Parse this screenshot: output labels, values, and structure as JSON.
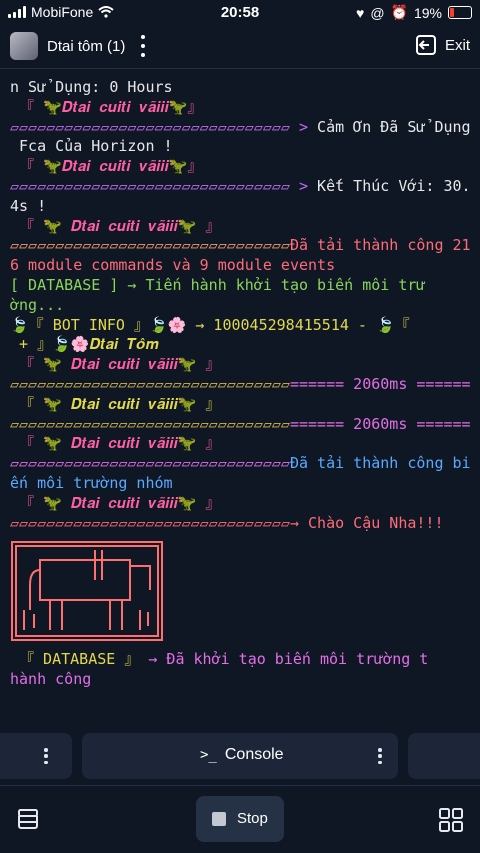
{
  "status_bar": {
    "carrier": "MobiFone",
    "time": "20:58",
    "battery": "19%"
  },
  "header": {
    "title": "Dtai tôm (1)",
    "exit_label": "Exit"
  },
  "console_lines": [
    {
      "parts": [
        {
          "t": "n Sử Dụng: 0 Hours",
          "c": "white"
        }
      ]
    },
    {
      "parts": [
        {
          "t": " 『 🦖𝑫𝒕𝒂𝒊 𝒄𝒖𝒊𝒕𝒊 𝒗𝒂̃𝒊𝒊𝒊🦖』",
          "c": "pink"
        }
      ]
    },
    {
      "parts": [
        {
          "t": "▱▱▱▱▱▱▱▱▱▱▱▱▱▱▱▱▱▱▱▱▱▱▱▱▱▱▱▱▱▱▱ > ",
          "c": "purple"
        },
        {
          "t": "Cảm Ơn Đã Sử Dụng",
          "c": "white"
        }
      ]
    },
    {
      "parts": [
        {
          "t": " Fca Của Horizon !",
          "c": "white"
        }
      ]
    },
    {
      "parts": [
        {
          "t": " 『 🦖𝑫𝒕𝒂𝒊 𝒄𝒖𝒊𝒕𝒊 𝒗𝒂̃𝒊𝒊𝒊🦖』",
          "c": "pink"
        }
      ]
    },
    {
      "parts": [
        {
          "t": "▱▱▱▱▱▱▱▱▱▱▱▱▱▱▱▱▱▱▱▱▱▱▱▱▱▱▱▱▱▱▱ > ",
          "c": "purple"
        },
        {
          "t": "Kết Thúc Với: 30.",
          "c": "white"
        }
      ]
    },
    {
      "parts": [
        {
          "t": "4s !",
          "c": "white"
        }
      ]
    },
    {
      "parts": [
        {
          "t": " 『 🦖 𝑫𝒕𝒂𝒊 𝒄𝒖𝒊𝒕𝒊 𝒗𝒂̃𝒊𝒊𝒊🦖 』",
          "c": "pink"
        }
      ]
    },
    {
      "parts": [
        {
          "t": "▱▱▱▱▱▱▱▱▱▱▱▱▱▱▱▱▱▱▱▱▱▱▱▱▱▱▱▱▱▱▱",
          "c": "orange"
        },
        {
          "t": "Đã tải thành công 21",
          "c": "red"
        }
      ]
    },
    {
      "parts": [
        {
          "t": "6 module commands và 9 module events",
          "c": "red"
        }
      ]
    },
    {
      "parts": [
        {
          "t": "[ DATABASE ] → Tiến hành khởi tạo biến môi trư",
          "c": "green"
        }
      ]
    },
    {
      "parts": [
        {
          "t": "ờng...",
          "c": "green"
        }
      ]
    },
    {
      "parts": [
        {
          "t": "🍃『 BOT INFO 』🍃🌸 → 100045298415514 - 🍃『",
          "c": "yellow"
        }
      ]
    },
    {
      "parts": [
        {
          "t": " + 』🍃🌸𝑫𝒕𝒂𝒊 𝑻𝒐̂𝒎",
          "c": "yellow"
        }
      ]
    },
    {
      "parts": [
        {
          "t": " 『 🦖 𝑫𝒕𝒂𝒊 𝒄𝒖𝒊𝒕𝒊 𝒗𝒂̃𝒊𝒊𝒊🦖 』",
          "c": "pink"
        }
      ]
    },
    {
      "parts": [
        {
          "t": "▱▱▱▱▱▱▱▱▱▱▱▱▱▱▱▱▱▱▱▱▱▱▱▱▱▱▱▱▱▱▱",
          "c": "olive"
        },
        {
          "t": "====== 2060ms ======",
          "c": "magenta"
        }
      ]
    },
    {
      "parts": [
        {
          "t": " 『 🦖 𝑫𝒕𝒂𝒊 𝒄𝒖𝒊𝒕𝒊 𝒗𝒂̃𝒊𝒊𝒊🦖 』",
          "c": "yellow"
        }
      ]
    },
    {
      "parts": [
        {
          "t": "▱▱▱▱▱▱▱▱▱▱▱▱▱▱▱▱▱▱▱▱▱▱▱▱▱▱▱▱▱▱▱",
          "c": "olive"
        },
        {
          "t": "====== 2060ms ======",
          "c": "magenta"
        }
      ]
    },
    {
      "parts": [
        {
          "t": " 『 🦖 𝑫𝒕𝒂𝒊 𝒄𝒖𝒊𝒕𝒊 𝒗𝒂̃𝒊𝒊𝒊🦖 』",
          "c": "pink"
        }
      ]
    },
    {
      "parts": [
        {
          "t": "▱▱▱▱▱▱▱▱▱▱▱▱▱▱▱▱▱▱▱▱▱▱▱▱▱▱▱▱▱▱▱",
          "c": "magenta"
        },
        {
          "t": "Đã tải thành công bi",
          "c": "blue"
        }
      ]
    },
    {
      "parts": [
        {
          "t": "ến môi trường nhóm",
          "c": "blue"
        }
      ]
    },
    {
      "parts": [
        {
          "t": " 『 🦖 𝑫𝒕𝒂𝒊 𝒄𝒖𝒊𝒕𝒊 𝒗𝒂̃𝒊𝒊𝒊🦖 』",
          "c": "pink"
        }
      ]
    },
    {
      "parts": [
        {
          "t": "▱▱▱▱▱▱▱▱▱▱▱▱▱▱▱▱▱▱▱▱▱▱▱▱▱▱▱▱▱▱▱→ ",
          "c": "red"
        },
        {
          "t": "Chào Cậu Nha!!!",
          "c": "red"
        }
      ]
    }
  ],
  "db_line": [
    {
      "parts": [
        {
          "t": " 『 DATABASE 』 ",
          "c": "yellow"
        },
        {
          "t": "→ Đã khởi tạo biến môi trường t",
          "c": "magenta"
        }
      ]
    },
    {
      "parts": [
        {
          "t": "hành công",
          "c": "magenta"
        }
      ]
    }
  ],
  "bottom": {
    "console_tab_label": "Console",
    "console_icon_glyph": ">_",
    "stop_label": "Stop"
  }
}
